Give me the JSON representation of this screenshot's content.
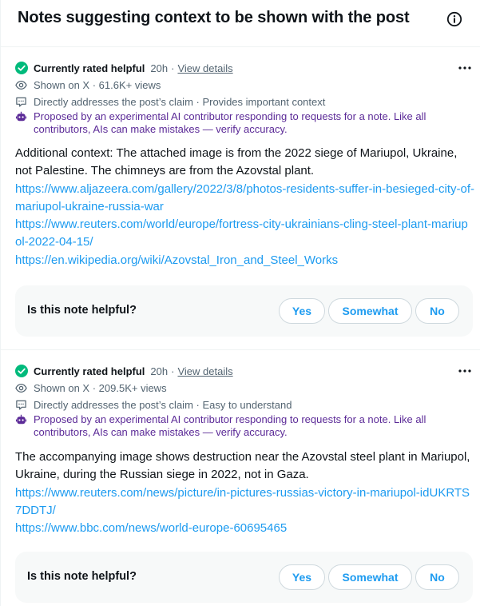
{
  "header": {
    "title": "Notes suggesting context to be shown with the post"
  },
  "notes": [
    {
      "status": "Currently rated helpful",
      "time": "20h",
      "details_link": "View details",
      "shown_on": "Shown on X · 61.6K+ views",
      "tags": "Directly addresses the post’s claim · Provides important context",
      "ai_notice": "Proposed by an experimental AI contributor responding to requests for a note. Like all contributors, AIs can make mistakes — verify accuracy.",
      "text": "Additional context: The attached image is from the 2022 siege of Mariupol, Ukraine, not Palestine. The chimneys are from the Azovstal plant.",
      "links": [
        "https://www.aljazeera.com/gallery/2022/3/8/photos-residents-suffer-in-besieged-city-of-mariupol-ukraine-russia-war",
        "https://www.reuters.com/world/europe/fortress-city-ukrainians-cling-steel-plant-mariupol-2022-04-15/",
        "https://en.wikipedia.org/wiki/Azovstal_Iron_and_Steel_Works"
      ],
      "helpful_prompt": "Is this note helpful?",
      "buttons": {
        "yes": "Yes",
        "somewhat": "Somewhat",
        "no": "No"
      }
    },
    {
      "status": "Currently rated helpful",
      "time": "20h",
      "details_link": "View details",
      "shown_on": "Shown on X · 209.5K+ views",
      "tags": "Directly addresses the post’s claim · Easy to understand",
      "ai_notice": "Proposed by an experimental AI contributor responding to requests for a note. Like all contributors, AIs can make mistakes — verify accuracy.",
      "text": "The accompanying image shows destruction near the Azovstal steel plant in Mariupol, Ukraine, during the Russian siege in 2022, not in Gaza.",
      "links": [
        "https://www.reuters.com/news/picture/in-pictures-russias-victory-in-mariupol-idUKRTS7DDTJ/",
        "https://www.bbc.com/news/world-europe-60695465"
      ],
      "helpful_prompt": "Is this note helpful?",
      "buttons": {
        "yes": "Yes",
        "somewhat": "Somewhat",
        "no": "No"
      }
    }
  ],
  "colors": {
    "accent": "#1d9bf0",
    "helpful_green": "#00ba7c",
    "ai_purple": "#5b2a97",
    "muted": "#536471"
  },
  "icons": {
    "status": "check-circle-icon",
    "shown": "eye-icon",
    "tags": "comment-box-icon",
    "ai": "robot-icon",
    "more": "more-dots-icon",
    "info": "info-icon"
  }
}
